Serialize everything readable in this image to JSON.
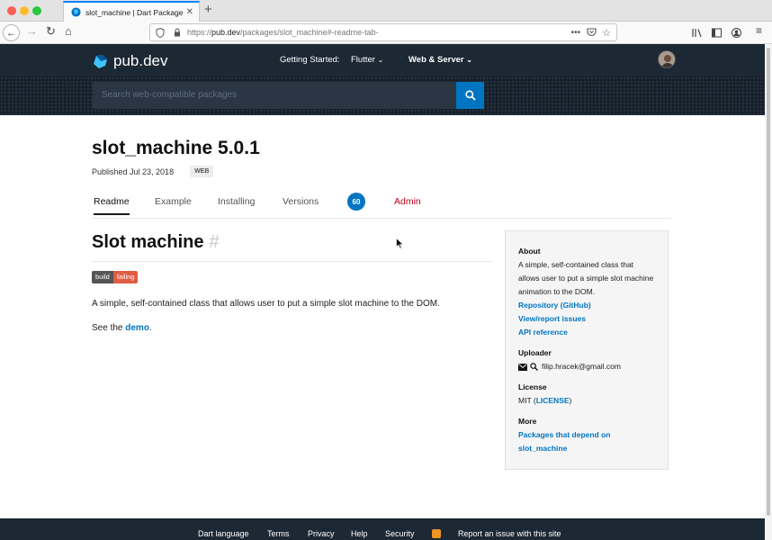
{
  "browser": {
    "tab_title": "slot_machine | Dart Package",
    "url_host": "pub.dev",
    "url_prefix": "https://",
    "url_path": "/packages/slot_machine#-readme-tab-",
    "colors": {
      "close": "#fc5f57",
      "minimize": "#fdbc2e",
      "maximize": "#28c840"
    }
  },
  "header": {
    "logo_text": "pub.dev",
    "getting_started": "Getting Started:",
    "flutter": "Flutter",
    "web_server": "Web & Server",
    "search_placeholder": "Search web-compatible packages"
  },
  "package": {
    "name_version": "slot_machine 5.0.1",
    "published": "Published Jul 23, 2018",
    "platform_tag": "WEB"
  },
  "tabs": {
    "readme": "Readme",
    "example": "Example",
    "installing": "Installing",
    "versions": "Versions",
    "score": "60",
    "admin": "Admin"
  },
  "readme": {
    "heading": "Slot machine",
    "hash": "#",
    "badge_left": "build",
    "badge_right": "failing",
    "description": "A simple, self-contained class that allows user to put a simple slot machine to the DOM.",
    "see_the": "See the ",
    "demo": "demo",
    "period": "."
  },
  "sidebar": {
    "about_head": "About",
    "about_text": "A simple, self-contained class that allows user to put a simple slot machine animation to the DOM.",
    "repository": "Repository (GitHub)",
    "issues": "View/report issues",
    "api": "API reference",
    "uploader_head": "Uploader",
    "uploader_email": "filip.hracek@gmail.com",
    "license_head": "License",
    "license_prefix": "MIT (",
    "license_link": "LICENSE",
    "license_suffix": ")",
    "more_head": "More",
    "depend_link": "Packages that depend on slot_machine"
  },
  "footer": {
    "dart_language": "Dart language",
    "terms": "Terms",
    "privacy": "Privacy",
    "help": "Help",
    "security": "Security",
    "report": "Report an issue with this site"
  }
}
